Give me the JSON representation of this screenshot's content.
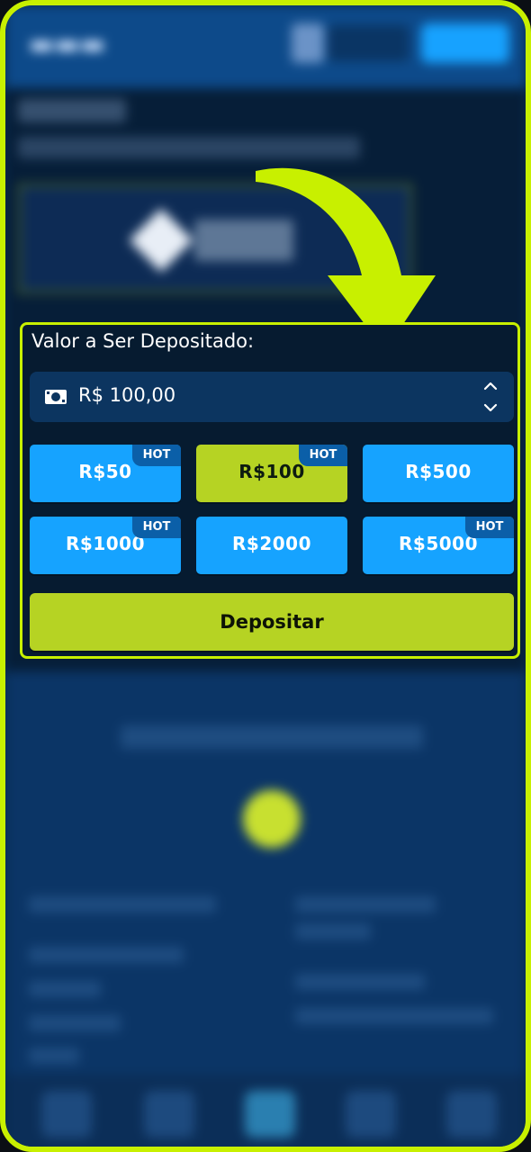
{
  "deposit": {
    "label": "Valor a Ser Depositado:",
    "amount": "R$ 100,00",
    "hot_badge": "HOT",
    "presets": [
      {
        "label": "R$50",
        "hot": true,
        "selected": false
      },
      {
        "label": "R$100",
        "hot": true,
        "selected": true
      },
      {
        "label": "R$500",
        "hot": false,
        "selected": false
      },
      {
        "label": "R$1000",
        "hot": true,
        "selected": false
      },
      {
        "label": "R$2000",
        "hot": false,
        "selected": false
      },
      {
        "label": "R$5000",
        "hot": true,
        "selected": false
      }
    ],
    "submit_label": "Depositar"
  },
  "icons": {
    "amount": "money-bill-icon",
    "increase": "chevron-up-icon",
    "decrease": "chevron-down-icon",
    "callout": "arrow-pointer-icon"
  },
  "colors": {
    "highlight": "#c8f000",
    "chip_blue": "#16a3ff",
    "chip_selected": "#b6d323",
    "panel_bg": "#061b30",
    "field_bg": "#0c3560",
    "hot_badge_bg": "#0b5fa8"
  }
}
